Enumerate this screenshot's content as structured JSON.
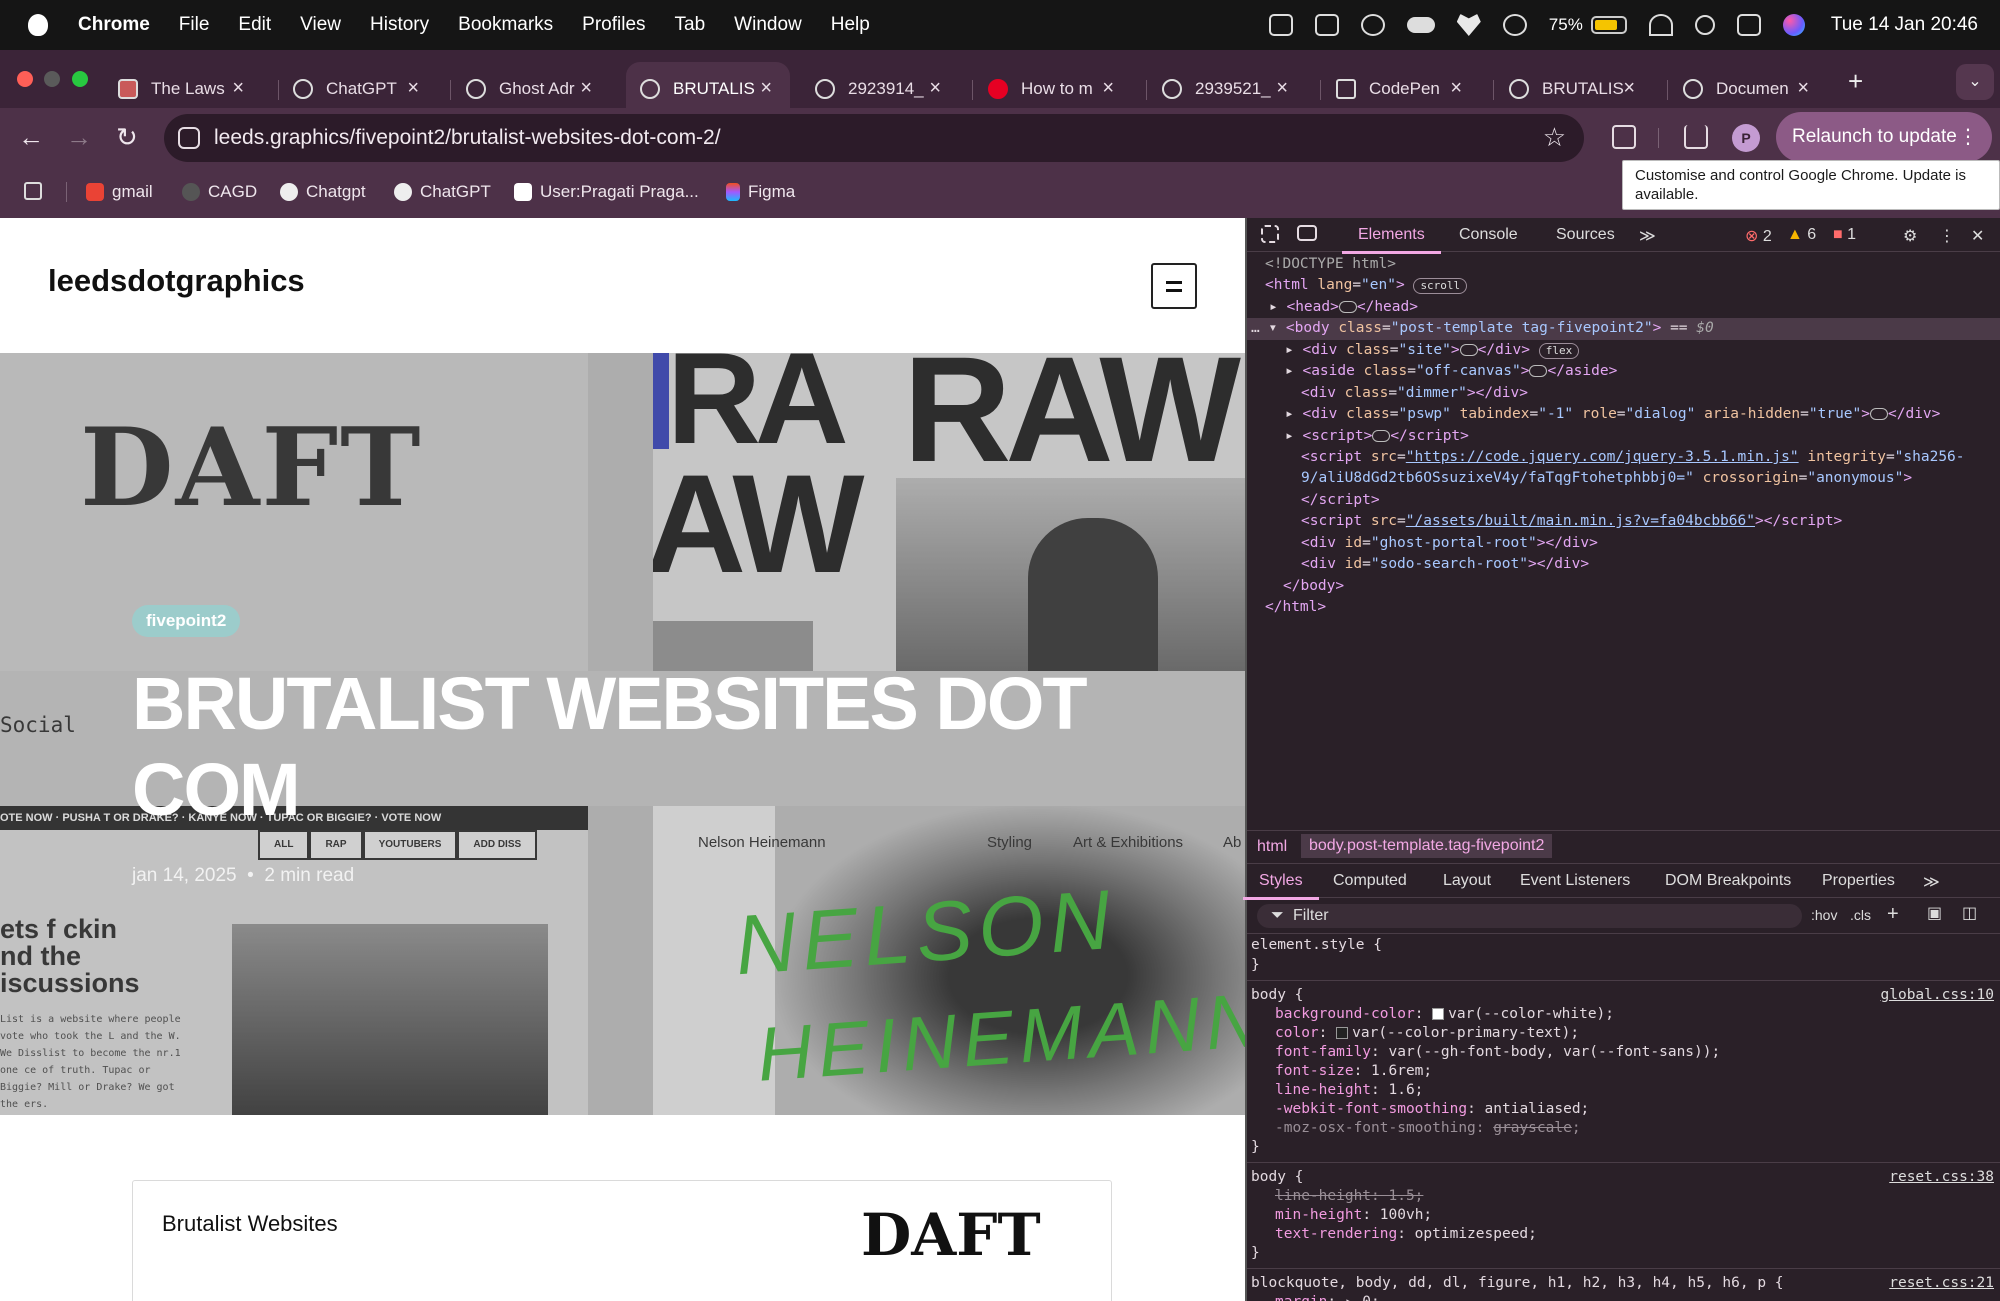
{
  "menubar": {
    "app": "Chrome",
    "items": [
      "File",
      "Edit",
      "View",
      "History",
      "Bookmarks",
      "Profiles",
      "Tab",
      "Window",
      "Help"
    ],
    "battery": "75%",
    "clock": "Tue 14 Jan  20:46"
  },
  "tabs": [
    {
      "title": "The Laws"
    },
    {
      "title": "ChatGPT"
    },
    {
      "title": "Ghost Adr"
    },
    {
      "title": "BRUTALIS",
      "active": true
    },
    {
      "title": "2923914_"
    },
    {
      "title": "How to m"
    },
    {
      "title": "2939521_"
    },
    {
      "title": "CodePen"
    },
    {
      "title": "BRUTALIS"
    },
    {
      "title": "Documen"
    }
  ],
  "toolbar": {
    "url": "leeds.graphics/fivepoint2/brutalist-websites-dot-com-2/",
    "avatar": "P",
    "relaunch": "Relaunch to update",
    "tooltip": "Customise and control Google Chrome. Update is available."
  },
  "bookmarks": [
    "gmail",
    "CAGD",
    "Chatgpt",
    "ChatGPT",
    "User:Pragati Praga...",
    "Figma"
  ],
  "site": {
    "name": "leedsdotgraphics",
    "badge": "fivepoint2",
    "title": "BRUTALIST WEBSITES DOT COM",
    "date": "jan 14, 2025",
    "read": "2 min read",
    "card_title": "Brutalist Websites",
    "card_logo": "DAFT"
  },
  "hero_art": {
    "daft": "DAFT",
    "raw1": "RA",
    "raw2": "RAW",
    "raw3": "AW",
    "social": "Social",
    "ticker": "OTE NOW  ·  PUSHA T OR DRAKE?  ·  KANYE NOW  ·  TUPAC OR BIGGIE?  ·  VOTE NOW",
    "chips": [
      "ALL",
      "RAP",
      "YOUTUBERS",
      "ADD DISS"
    ],
    "rap_heading": "ets f ckin\nnd the\niscussions",
    "rap_para": "List is a website where people vote who took the L and the W. We Disslist to become the nr.1 one ce of truth. Tupac or Biggie? Mill or Drake? We got the ers.",
    "nelson_nav": [
      "Nelson Heinemann",
      "Styling",
      "Art & Exhibitions",
      "Ab"
    ],
    "scrib1": "NELSON",
    "scrib2": "HEINEMANN"
  },
  "devtools": {
    "tabs": [
      "Elements",
      "Console",
      "Sources"
    ],
    "errors": "2",
    "warnings": "6",
    "issues": "1",
    "crumbs": [
      "html",
      "body.post-template.tag-fivepoint2"
    ],
    "subtabs": [
      "Styles",
      "Computed",
      "Layout",
      "Event Listeners",
      "DOM Breakpoints",
      "Properties"
    ],
    "filter_placeholder": "Filter",
    "hov": ":hov",
    "cls": ".cls"
  }
}
